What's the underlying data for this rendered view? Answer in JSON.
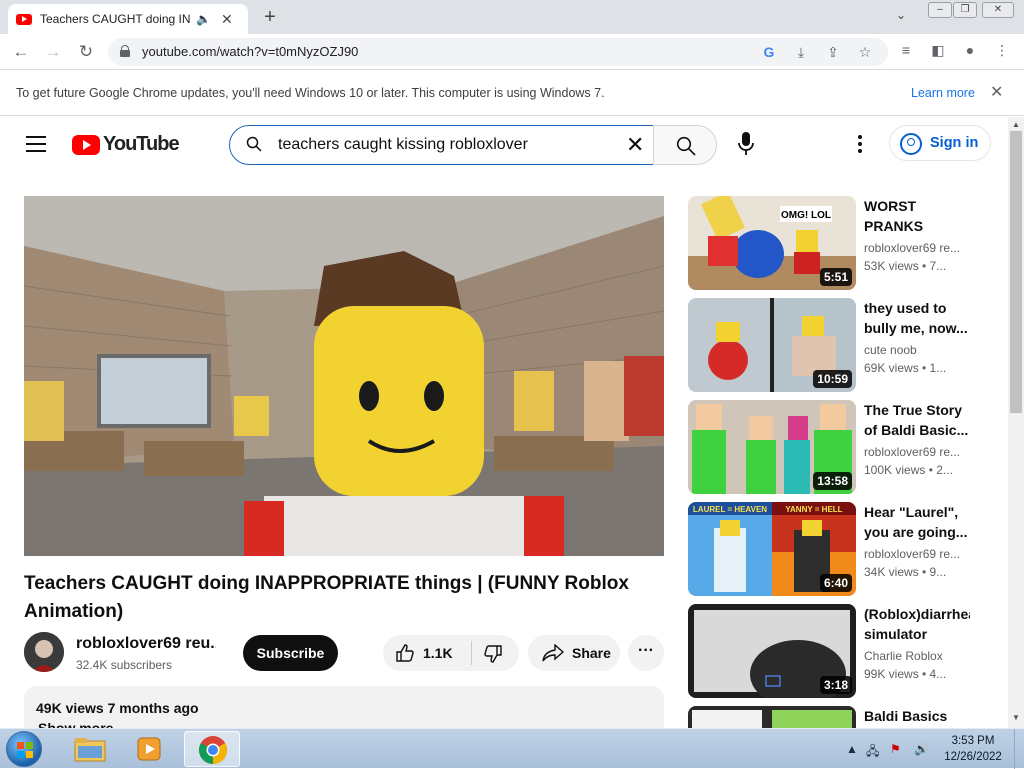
{
  "browser": {
    "tab_title": "Teachers CAUGHT doing INAPPROPRIATE things",
    "url": "youtube.com/watch?v=t0mNyzOZJ90",
    "new_tab_label": "+",
    "tab_close_label": "✕"
  },
  "infobar": {
    "message": "To get future Google Chrome updates, you'll need Windows 10 or later. This computer is using Windows 7.",
    "link": "Learn more"
  },
  "youtube": {
    "logo_text": "YouTube",
    "search_query": "teachers caught kissing robloxlover",
    "sign_in": "Sign in"
  },
  "video": {
    "title": "Teachers CAUGHT doing INAPPROPRIATE things | (FUNNY Roblox Animation)",
    "channel": "robloxlover69 reu...",
    "subscribers": "32.4K subscribers",
    "subscribe_label": "Subscribe",
    "likes": "1.1K",
    "share_label": "Share",
    "more_label": "···",
    "meta": "49K views  7 months ago",
    "show_more": "Show more"
  },
  "recommendations": [
    {
      "title": "WORST PRANKS used...",
      "channel": "robloxlover69 re...",
      "views": "53K views  • 7...",
      "duration": "5:51",
      "thumb_text": "OMG! LOL"
    },
    {
      "title": "they used to bully me, now...",
      "channel": "cute noob",
      "views": "69K views  • 1...",
      "duration": "10:59"
    },
    {
      "title": "The True Story of Baldi Basic...",
      "channel": "robloxlover69 re...",
      "views": "100K views  • 2...",
      "duration": "13:58"
    },
    {
      "title": "Hear \"Laurel\", you are going...",
      "channel": "robloxlover69 re...",
      "views": "34K views  • 9...",
      "duration": "6:40",
      "thumb_left": "LAUREL = HEAVEN",
      "thumb_right": "YANNY = HELL"
    },
    {
      "title": "(Roblox)diarrhea simulator",
      "channel": "Charlie Roblox",
      "views": "99K views  • 4...",
      "duration": "3:18"
    },
    {
      "title": "Baldi Basics",
      "channel": "",
      "views": "",
      "duration": ""
    }
  ],
  "taskbar": {
    "time": "3:53 PM",
    "date": "12/26/2022"
  },
  "colors": {
    "youtube_red": "#ff0000",
    "link_blue": "#065fd4",
    "chrome_tabstrip": "#dee1e6"
  }
}
